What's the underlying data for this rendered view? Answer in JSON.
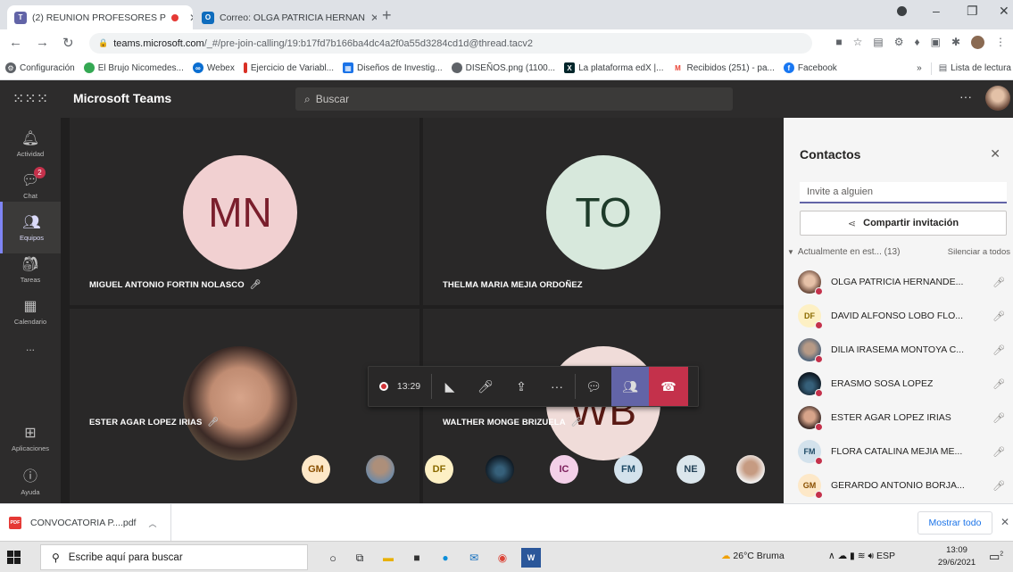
{
  "browser": {
    "tabs": [
      {
        "title": "(2) REUNION PROFESORES P"
      },
      {
        "title": "Correo: OLGA PATRICIA HERNAN"
      }
    ],
    "url_domain": "teams.microsoft.com",
    "url_path": "/_#/pre-join-calling/19:b17fd7b166ba4dc4a2f0a55d3284cd1d@thread.tacv2",
    "bookmarks": [
      {
        "label": "Configuración",
        "color": "#5f6368"
      },
      {
        "label": "El Brujo Nicomedes...",
        "color": "#34a853"
      },
      {
        "label": "Webex",
        "color": "#0a6ed1"
      },
      {
        "label": "Ejercicio de Variabl...",
        "color": "#d93025"
      },
      {
        "label": "Diseños de Investig...",
        "color": "#1a73e8"
      },
      {
        "label": "DISEÑOS.png (1100...",
        "color": "#5f6368"
      },
      {
        "label": "La plataforma edX |...",
        "color": "#02262b"
      },
      {
        "label": "Recibidos (251) - pa...",
        "color": "#ea4335"
      },
      {
        "label": "Facebook",
        "color": "#1877f2"
      }
    ],
    "bookmarks_more": "»",
    "reading_list": "Lista de lectura"
  },
  "teams": {
    "brand": "Microsoft Teams",
    "search_placeholder": "Buscar",
    "rail": [
      {
        "label": "Actividad",
        "icon": "bell-icon"
      },
      {
        "label": "Chat",
        "icon": "chat-icon",
        "badge": "2"
      },
      {
        "label": "Equipos",
        "icon": "teams-icon"
      },
      {
        "label": "Tareas",
        "icon": "tasks-icon"
      },
      {
        "label": "Calendario",
        "icon": "calendar-icon"
      },
      {
        "label": "...",
        "icon": "more-icon"
      },
      {
        "label": "Aplicaciones",
        "icon": "apps-icon"
      },
      {
        "label": "Ayuda",
        "icon": "help-icon"
      }
    ]
  },
  "tiles": [
    {
      "initials": "MN",
      "name": "MIGUEL ANTONIO FORTIN NOLASCO",
      "color": "#f1d0d1"
    },
    {
      "initials": "TO",
      "name": "THELMA MARIA MEJIA ORDOÑEZ",
      "color": "#d7e8dc"
    },
    {
      "initials": "",
      "name": "ESTER AGAR LOPEZ IRIAS",
      "color": "#6b4a3b"
    },
    {
      "initials": "WB",
      "name": "WALTHER MONGE BRIZUELA",
      "color": "#f0dcd9"
    }
  ],
  "callbar": {
    "recording_time": "13:29"
  },
  "strip": [
    {
      "initials": "GM",
      "color": "#fde8c8",
      "text": "#8a4f00"
    },
    {
      "initials": "",
      "color": "#8fa3b8",
      "text": "#fff"
    },
    {
      "initials": "DF",
      "color": "#fdf0c4",
      "text": "#8a6a00"
    },
    {
      "initials": "",
      "color": "#1c2b3a",
      "text": "#fff"
    },
    {
      "initials": "IC",
      "color": "#f3d0e8",
      "text": "#7a1d5a"
    },
    {
      "initials": "FM",
      "color": "#d3e2ec",
      "text": "#1e4a66"
    },
    {
      "initials": "NE",
      "color": "#dbe6ec",
      "text": "#264459"
    },
    {
      "initials": "",
      "color": "#e8d3c2",
      "text": "#fff"
    }
  ],
  "panel": {
    "title": "Contactos",
    "invite_placeholder": "Invite a alguien",
    "share_label": "Compartir invitación",
    "current_label": "Actualmente en est... (13)",
    "mute_all": "Silenciar a todos",
    "people": [
      {
        "name": "OLGA PATRICIA HERNANDE...",
        "initials": "",
        "color": "#b07a63",
        "text": "#fff"
      },
      {
        "name": "DAVID ALFONSO LOBO FLO...",
        "initials": "DF",
        "color": "#fdf0c4",
        "text": "#8a6a00"
      },
      {
        "name": "DILIA IRASEMA MONTOYA C...",
        "initials": "",
        "color": "#7a8fa6",
        "text": "#fff"
      },
      {
        "name": "ERASMO SOSA LOPEZ",
        "initials": "",
        "color": "#1c2b3a",
        "text": "#fff"
      },
      {
        "name": "ESTER AGAR LOPEZ IRIAS",
        "initials": "",
        "color": "#b07a63",
        "text": "#fff"
      },
      {
        "name": "FLORA CATALINA MEJIA ME...",
        "initials": "FM",
        "color": "#d3e2ec",
        "text": "#1e4a66"
      },
      {
        "name": "GERARDO ANTONIO BORJA...",
        "initials": "GM",
        "color": "#fde8c8",
        "text": "#8a4f00"
      }
    ]
  },
  "downloads": {
    "file": "CONVOCATORIA P....pdf",
    "file_type": "PDF",
    "show_all": "Mostrar todo"
  },
  "taskbar": {
    "search_placeholder": "Escribe aquí para buscar",
    "weather": "26°C  Bruma",
    "lang": "ESP",
    "time": "13:09",
    "date": "29/6/2021",
    "notif_count": "2"
  }
}
